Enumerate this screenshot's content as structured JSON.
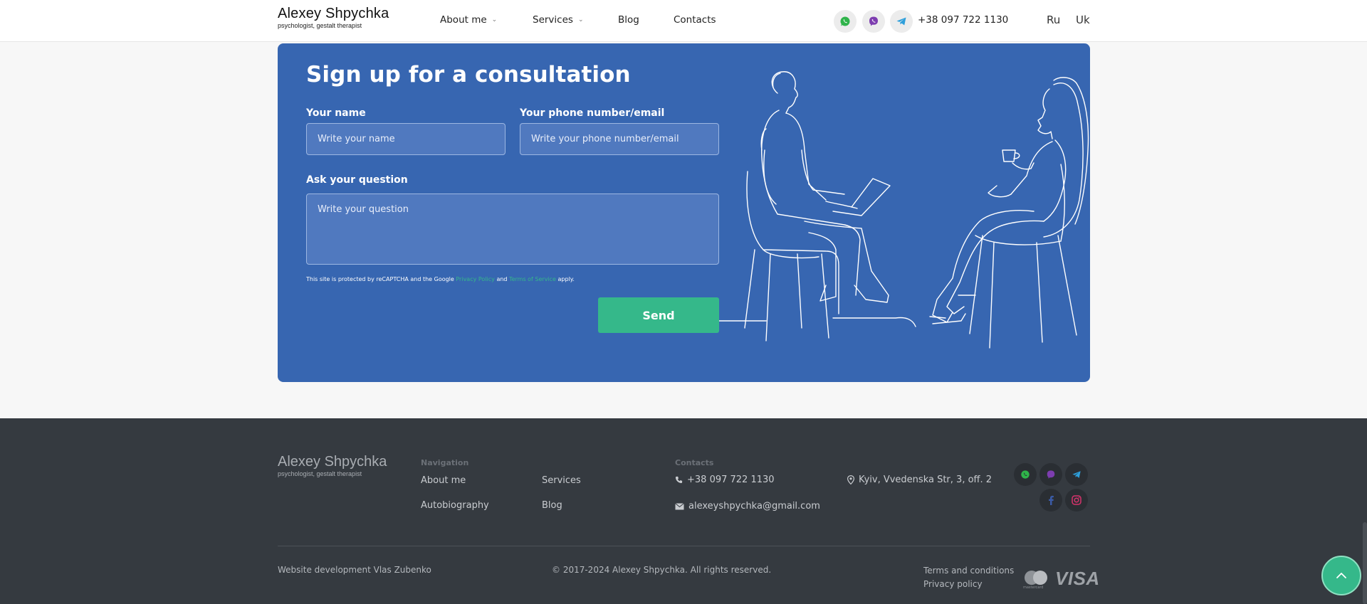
{
  "header": {
    "logo_name": "Alexey Shpychka",
    "logo_sub": "psychologist, gestalt therapist",
    "nav": {
      "about": "About me",
      "services": "Services",
      "blog": "Blog",
      "contacts": "Contacts"
    },
    "phone": "+38 097 722 1130",
    "languages": {
      "ru": "Ru",
      "uk": "Uk"
    },
    "icons": [
      "whatsapp-icon",
      "viber-icon",
      "telegram-icon"
    ]
  },
  "form": {
    "title": "Sign up for a consultation",
    "name_label": "Your name",
    "name_placeholder": "Write your name",
    "phone_label": "Your phone number/email",
    "phone_placeholder": "Write your phone number/email",
    "question_label": "Ask your question",
    "question_placeholder": "Write your question",
    "recaptcha": {
      "prefix": "This site is protected by reCAPTCHA and the Google ",
      "privacy": "Privacy Policy",
      "and": " and ",
      "terms": "Terms of Service",
      "suffix": " apply."
    },
    "send_label": "Send"
  },
  "footer": {
    "logo_name": "Alexey Shpychka",
    "logo_sub": "psychologist, gestalt therapist",
    "nav_heading": "Navigation",
    "nav_links": {
      "about": "About me",
      "services": "Services",
      "autobiography": "Autobiography",
      "blog": "Blog"
    },
    "contacts_heading": "Contacts",
    "phone": "+38 097 722 1130",
    "email": "alexeyshpychka@gmail.com",
    "address": "Kyiv, Vvedenska Str, 3, off. 2",
    "dev": "Website development Vlas Zubenko",
    "copyright": "© 2017-2024 Alexey Shpychka. All rights reserved.",
    "terms": "Terms and conditions",
    "privacy": "Privacy policy",
    "payment": {
      "visa": "VISA",
      "mastercard": "mastercard"
    }
  },
  "colors": {
    "accent_blue": "#3766b1",
    "accent_green": "#35b88a",
    "footer_bg": "#353a40"
  }
}
